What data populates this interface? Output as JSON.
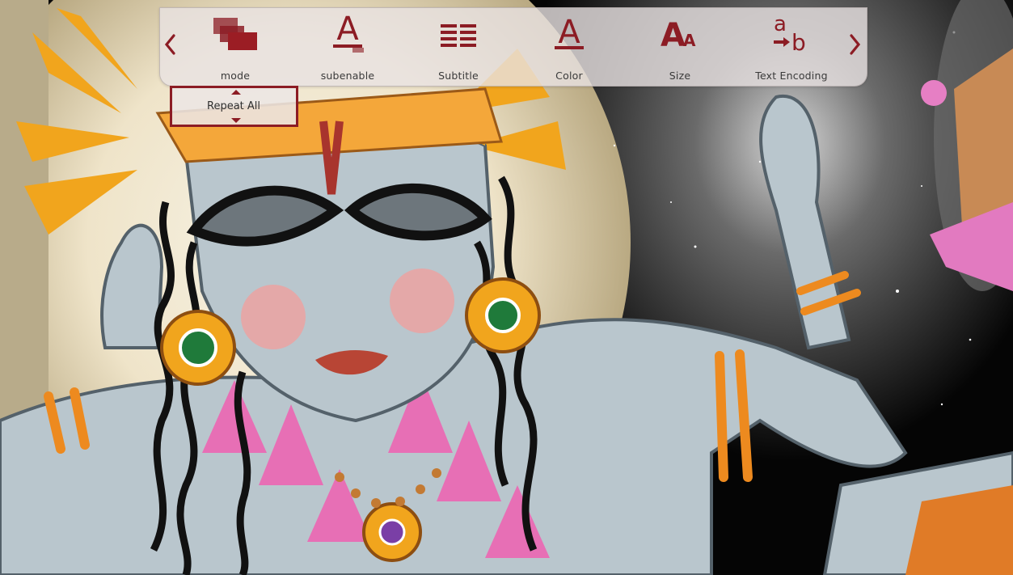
{
  "toolbar": {
    "prev_arrow": "chevron-left-icon",
    "next_arrow": "chevron-right-icon",
    "items": [
      {
        "label": "mode",
        "icon": "stacked-windows-icon"
      },
      {
        "label": "subenable",
        "icon": "letter-a-underline-icon"
      },
      {
        "label": "Subtitle",
        "icon": "subtitle-lines-icon"
      },
      {
        "label": "Color",
        "icon": "letter-a-color-icon"
      },
      {
        "label": "Size",
        "icon": "letter-a-size-icon"
      },
      {
        "label": "Text Encoding",
        "icon": "text-encoding-a-to-b-icon"
      }
    ]
  },
  "mode_popup": {
    "value": "Repeat All"
  },
  "colors": {
    "accent": "#8c1c24",
    "toolbar_bg": "#e8e2e2"
  }
}
